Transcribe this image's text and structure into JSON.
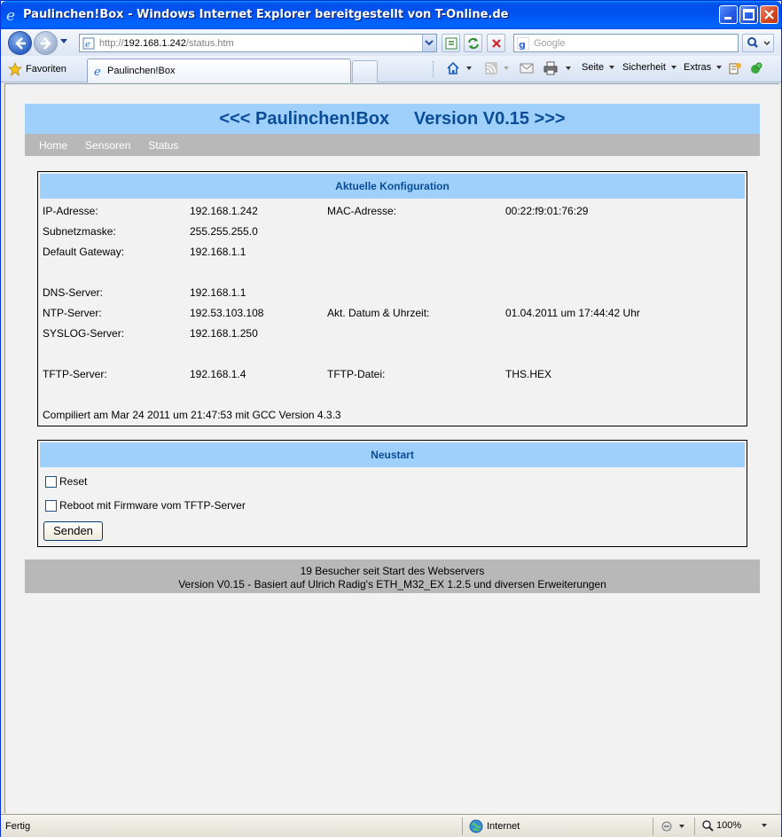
{
  "window": {
    "title": "Paulinchen!Box - Windows Internet Explorer bereitgestellt von T-Online.de"
  },
  "address_bar": {
    "url_prefix": "http://",
    "url_host": "192.168.1.242",
    "url_path": "/status.htm"
  },
  "search": {
    "placeholder": "Google"
  },
  "command_bar": {
    "favorites_label": "Favoriten",
    "tab_label": "Paulinchen!Box",
    "page_label": "Seite",
    "safety_label": "Sicherheit",
    "extras_label": "Extras"
  },
  "page": {
    "header": "<<< Paulinchen!Box     Version V0.15 >>>",
    "menu": [
      "Home",
      "Sensoren",
      "Status"
    ],
    "config": {
      "title": "Aktuelle Konfiguration",
      "ip_label": "IP-Adresse:",
      "ip_value": "192.168.1.242",
      "mac_label": "MAC-Adresse:",
      "mac_value": "00:22:f9:01:76:29",
      "subnet_label": "Subnetzmaske:",
      "subnet_value": "255.255.255.0",
      "gateway_label": "Default Gateway:",
      "gateway_value": "192.168.1.1",
      "dns_label": "DNS-Server:",
      "dns_value": "192.168.1.1",
      "ntp_label": "NTP-Server:",
      "ntp_value": "192.53.103.108",
      "datetime_label": "Akt. Datum & Uhrzeit:",
      "datetime_value": "01.04.2011 um 17:44:42 Uhr",
      "syslog_label": "SYSLOG-Server:",
      "syslog_value": "192.168.1.250",
      "tftp_label": "TFTP-Server:",
      "tftp_value": "192.168.1.4",
      "tftp_file_label": "TFTP-Datei:",
      "tftp_file_value": "THS.HEX",
      "compiled": "Compiliert am Mar 24 2011 um 21:47:53 mit GCC Version 4.3.3"
    },
    "restart": {
      "title": "Neustart",
      "reset_label": "Reset",
      "reboot_label": "Reboot mit Firmware vom TFTP-Server",
      "submit_label": "Senden"
    },
    "footer": {
      "line1": "19 Besucher seit Start des Webservers",
      "line2": "Version V0.15 - Basiert auf Ulrich Radig's ETH_M32_EX 1.2.5 und diversen Erweiterungen"
    }
  },
  "status_bar": {
    "status": "Fertig",
    "zone": "Internet",
    "zoom": "100%"
  },
  "colors": {
    "header_blue": "#9fd0fb",
    "header_text": "#0a4d96",
    "menu_gray": "#b8b8b8"
  }
}
